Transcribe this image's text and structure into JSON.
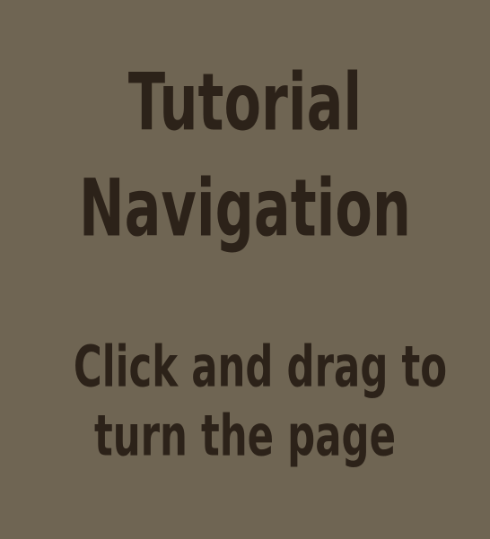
{
  "page": {
    "title_lines": [
      "Tutorial",
      "Navigation"
    ],
    "instruction_lines": [
      "Click and drag to",
      "turn the page"
    ]
  },
  "colors": {
    "background": "#6f6553",
    "text": "#2c2219"
  }
}
